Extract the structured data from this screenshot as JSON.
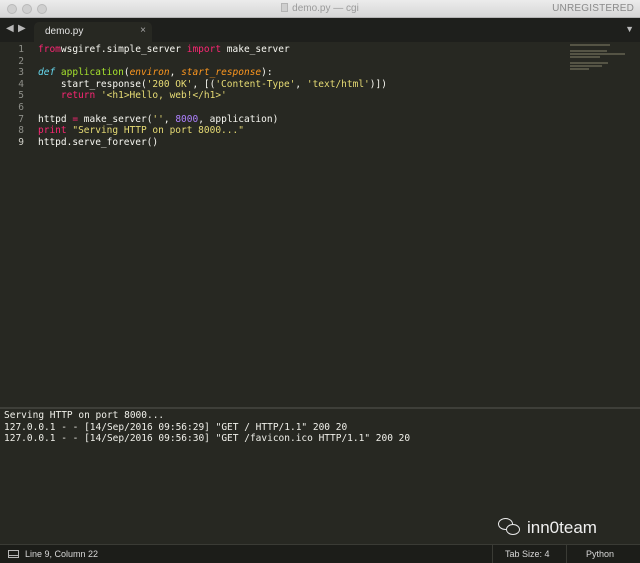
{
  "window": {
    "title": "demo.py — cgi",
    "badge": "UNREGISTERED"
  },
  "tabs": [
    {
      "label": "demo.py",
      "close": "×"
    }
  ],
  "nav": {
    "back": "◀",
    "forward": "▶",
    "menu": "▼"
  },
  "editor": {
    "line_numbers": [
      "1",
      "2",
      "3",
      "4",
      "5",
      "6",
      "7",
      "8",
      "9"
    ],
    "current_line": 9,
    "lines": [
      [
        [
          "kw",
          "from"
        ],
        [
          "",
          "wsgiref.simple_server "
        ],
        [
          "kw",
          "import"
        ],
        [
          "",
          " make_server"
        ]
      ],
      [],
      [
        [
          "df",
          "def"
        ],
        [
          "",
          " "
        ],
        [
          "fn",
          "application"
        ],
        [
          "",
          "("
        ],
        [
          "pa",
          "environ"
        ],
        [
          "",
          ", "
        ],
        [
          "pa",
          "start_response"
        ],
        [
          "",
          "):"
        ]
      ],
      [
        [
          "",
          "    start_response("
        ],
        [
          "st",
          "'200 OK'"
        ],
        [
          "",
          ", [("
        ],
        [
          "st",
          "'Content-Type'"
        ],
        [
          "",
          ", "
        ],
        [
          "st",
          "'text/html'"
        ],
        [
          "",
          ")])"
        ]
      ],
      [
        [
          "",
          "    "
        ],
        [
          "kw",
          "return"
        ],
        [
          "",
          " "
        ],
        [
          "st",
          "'<h1>Hello, web!</h1>'"
        ]
      ],
      [],
      [
        [
          "",
          "httpd "
        ],
        [
          "kw",
          "="
        ],
        [
          "",
          " make_server("
        ],
        [
          "st",
          "''"
        ],
        [
          "",
          ", "
        ],
        [
          "nm",
          "8000"
        ],
        [
          "",
          ", application)"
        ]
      ],
      [
        [
          "kw",
          "print"
        ],
        [
          "",
          " "
        ],
        [
          "st",
          "\"Serving HTTP on port 8000...\""
        ]
      ],
      [
        [
          "",
          "httpd.serve_forever()"
        ]
      ]
    ]
  },
  "console": {
    "lines": [
      "Serving HTTP on port 8000...",
      "127.0.0.1 - - [14/Sep/2016 09:56:29] \"GET / HTTP/1.1\" 200 20",
      "127.0.0.1 - - [14/Sep/2016 09:56:30] \"GET /favicon.ico HTTP/1.1\" 200 20"
    ]
  },
  "watermark": {
    "text": "inn0team"
  },
  "status": {
    "position": "Line 9, Column 22",
    "tab_size": "Tab Size: 4",
    "syntax": "Python"
  },
  "colors": {
    "background": "#272822",
    "keyword": "#f92672",
    "function": "#a6e22e",
    "string": "#e6db74",
    "number": "#ae81ff",
    "storage": "#66d9ef"
  }
}
